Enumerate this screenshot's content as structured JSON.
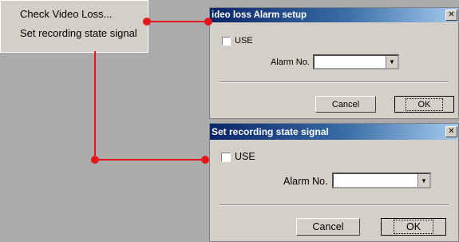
{
  "menu": {
    "items": [
      "Check Video Loss...",
      "Set recording state signal"
    ]
  },
  "dialog1": {
    "title": "ideo loss Alarm setup",
    "use_label": "USE",
    "alarm_label": "Alarm No.",
    "alarm_value": "",
    "cancel": "Cancel",
    "ok": "OK"
  },
  "dialog2": {
    "title": "Set recording state signal",
    "use_label": "USE",
    "alarm_label": "Alarm No.",
    "alarm_value": "",
    "cancel": "Cancel",
    "ok": "OK"
  },
  "colors": {
    "connector": "#e3161b",
    "title_start": "#0a246a",
    "title_end": "#a6caf0"
  }
}
